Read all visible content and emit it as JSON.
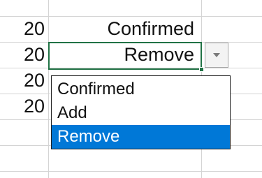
{
  "sheet": {
    "rows": [
      {
        "number": "20",
        "status": "Confirmed"
      },
      {
        "number": "20",
        "status": "Remove"
      },
      {
        "number": "20",
        "status": ""
      },
      {
        "number": "20",
        "status": ""
      },
      {
        "number": "",
        "status": ""
      },
      {
        "number": "",
        "status": ""
      }
    ]
  },
  "dropdown": {
    "selected": "Remove",
    "options": [
      "Confirmed",
      "Add",
      "Remove"
    ],
    "icon": "chevron-down-icon"
  },
  "colors": {
    "selection_border": "#217346",
    "list_highlight": "#0078d7",
    "gridline": "#d4d4d4"
  }
}
